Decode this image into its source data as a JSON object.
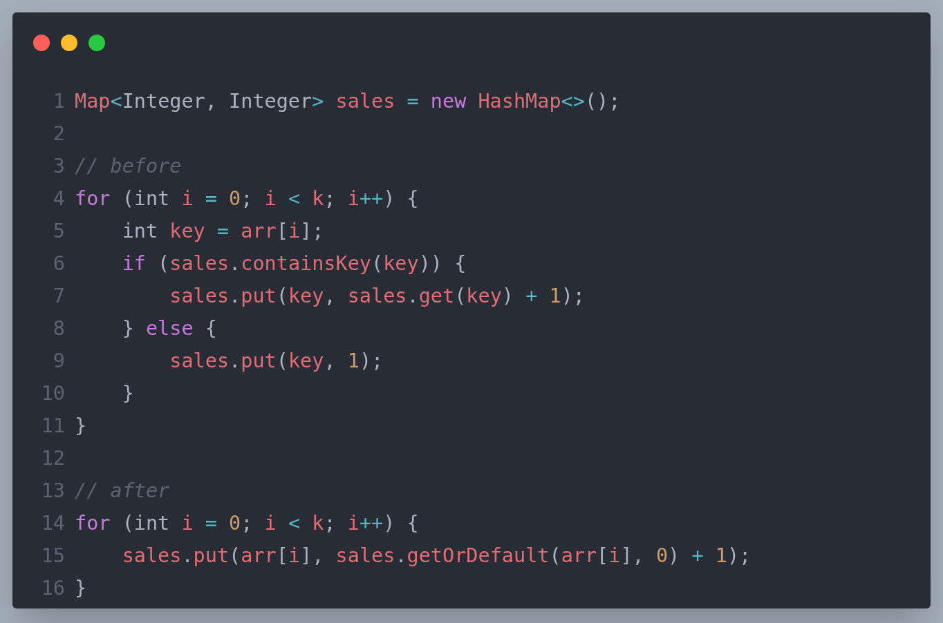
{
  "window": {
    "controls": [
      {
        "kind": "close"
      },
      {
        "kind": "minimize"
      },
      {
        "kind": "zoom"
      }
    ]
  },
  "code": {
    "lines": [
      {
        "number": "1",
        "tokens": [
          {
            "kind": "var",
            "text": "Map"
          },
          {
            "kind": "op",
            "text": "<"
          },
          {
            "kind": "plain",
            "text": "Integer, Integer"
          },
          {
            "kind": "op",
            "text": "> "
          },
          {
            "kind": "var",
            "text": "sales "
          },
          {
            "kind": "op",
            "text": "= "
          },
          {
            "kind": "keyword",
            "text": "new "
          },
          {
            "kind": "var",
            "text": "HashMap"
          },
          {
            "kind": "op",
            "text": "<>"
          },
          {
            "kind": "plain",
            "text": "();"
          }
        ]
      },
      {
        "number": "2"
      },
      {
        "number": "3",
        "tokens": [
          {
            "kind": "comment",
            "text": "// before"
          }
        ]
      },
      {
        "number": "4",
        "tokens": [
          {
            "kind": "keyword",
            "text": "for"
          },
          {
            "kind": "plain",
            "text": " (int "
          },
          {
            "kind": "var",
            "text": "i "
          },
          {
            "kind": "op",
            "text": "= "
          },
          {
            "kind": "num",
            "text": "0"
          },
          {
            "kind": "plain",
            "text": "; "
          },
          {
            "kind": "var",
            "text": "i "
          },
          {
            "kind": "op",
            "text": "< "
          },
          {
            "kind": "var",
            "text": "k"
          },
          {
            "kind": "plain",
            "text": "; "
          },
          {
            "kind": "var",
            "text": "i"
          },
          {
            "kind": "op",
            "text": "++"
          },
          {
            "kind": "plain",
            "text": ") {"
          }
        ]
      },
      {
        "number": "5",
        "tokens": [
          {
            "kind": "plain",
            "text": "    int "
          },
          {
            "kind": "var",
            "text": "key "
          },
          {
            "kind": "op",
            "text": "= "
          },
          {
            "kind": "var",
            "text": "arr"
          },
          {
            "kind": "plain",
            "text": "["
          },
          {
            "kind": "var",
            "text": "i"
          },
          {
            "kind": "plain",
            "text": "];"
          }
        ]
      },
      {
        "number": "6",
        "tokens": [
          {
            "kind": "keyword",
            "text": "    if"
          },
          {
            "kind": "plain",
            "text": " ("
          },
          {
            "kind": "var",
            "text": "sales"
          },
          {
            "kind": "plain",
            "text": "."
          },
          {
            "kind": "var",
            "text": "containsKey"
          },
          {
            "kind": "plain",
            "text": "("
          },
          {
            "kind": "var",
            "text": "key"
          },
          {
            "kind": "plain",
            "text": ")) {"
          }
        ]
      },
      {
        "number": "7",
        "tokens": [
          {
            "kind": "var",
            "text": "        sales"
          },
          {
            "kind": "plain",
            "text": "."
          },
          {
            "kind": "var",
            "text": "put"
          },
          {
            "kind": "plain",
            "text": "("
          },
          {
            "kind": "var",
            "text": "key"
          },
          {
            "kind": "plain",
            "text": ", "
          },
          {
            "kind": "var",
            "text": "sales"
          },
          {
            "kind": "plain",
            "text": "."
          },
          {
            "kind": "var",
            "text": "get"
          },
          {
            "kind": "plain",
            "text": "("
          },
          {
            "kind": "var",
            "text": "key"
          },
          {
            "kind": "plain",
            "text": ") "
          },
          {
            "kind": "op",
            "text": "+ "
          },
          {
            "kind": "num",
            "text": "1"
          },
          {
            "kind": "plain",
            "text": ");"
          }
        ]
      },
      {
        "number": "8",
        "tokens": [
          {
            "kind": "plain",
            "text": "    } "
          },
          {
            "kind": "keyword",
            "text": "else"
          },
          {
            "kind": "plain",
            "text": " {"
          }
        ]
      },
      {
        "number": "9",
        "tokens": [
          {
            "kind": "var",
            "text": "        sales"
          },
          {
            "kind": "plain",
            "text": "."
          },
          {
            "kind": "var",
            "text": "put"
          },
          {
            "kind": "plain",
            "text": "("
          },
          {
            "kind": "var",
            "text": "key"
          },
          {
            "kind": "plain",
            "text": ", "
          },
          {
            "kind": "num",
            "text": "1"
          },
          {
            "kind": "plain",
            "text": ");"
          }
        ]
      },
      {
        "number": "10",
        "tokens": [
          {
            "kind": "plain",
            "text": "    }"
          }
        ]
      },
      {
        "number": "11",
        "tokens": [
          {
            "kind": "plain",
            "text": "}"
          }
        ]
      },
      {
        "number": "12"
      },
      {
        "number": "13",
        "tokens": [
          {
            "kind": "comment",
            "text": "// after"
          }
        ]
      },
      {
        "number": "14",
        "tokens": [
          {
            "kind": "keyword",
            "text": "for"
          },
          {
            "kind": "plain",
            "text": " (int "
          },
          {
            "kind": "var",
            "text": "i "
          },
          {
            "kind": "op",
            "text": "= "
          },
          {
            "kind": "num",
            "text": "0"
          },
          {
            "kind": "plain",
            "text": "; "
          },
          {
            "kind": "var",
            "text": "i "
          },
          {
            "kind": "op",
            "text": "< "
          },
          {
            "kind": "var",
            "text": "k"
          },
          {
            "kind": "plain",
            "text": "; "
          },
          {
            "kind": "var",
            "text": "i"
          },
          {
            "kind": "op",
            "text": "++"
          },
          {
            "kind": "plain",
            "text": ") {"
          }
        ]
      },
      {
        "number": "15",
        "tokens": [
          {
            "kind": "var",
            "text": "    sales"
          },
          {
            "kind": "plain",
            "text": "."
          },
          {
            "kind": "var",
            "text": "put"
          },
          {
            "kind": "plain",
            "text": "("
          },
          {
            "kind": "var",
            "text": "arr"
          },
          {
            "kind": "plain",
            "text": "["
          },
          {
            "kind": "var",
            "text": "i"
          },
          {
            "kind": "plain",
            "text": "], "
          },
          {
            "kind": "var",
            "text": "sales"
          },
          {
            "kind": "plain",
            "text": "."
          },
          {
            "kind": "var",
            "text": "getOrDefault"
          },
          {
            "kind": "plain",
            "text": "("
          },
          {
            "kind": "var",
            "text": "arr"
          },
          {
            "kind": "plain",
            "text": "["
          },
          {
            "kind": "var",
            "text": "i"
          },
          {
            "kind": "plain",
            "text": "], "
          },
          {
            "kind": "num",
            "text": "0"
          },
          {
            "kind": "plain",
            "text": ") "
          },
          {
            "kind": "op",
            "text": "+ "
          },
          {
            "kind": "num",
            "text": "1"
          },
          {
            "kind": "plain",
            "text": ");"
          }
        ]
      },
      {
        "number": "16",
        "tokens": [
          {
            "kind": "plain",
            "text": "}"
          }
        ]
      }
    ]
  }
}
